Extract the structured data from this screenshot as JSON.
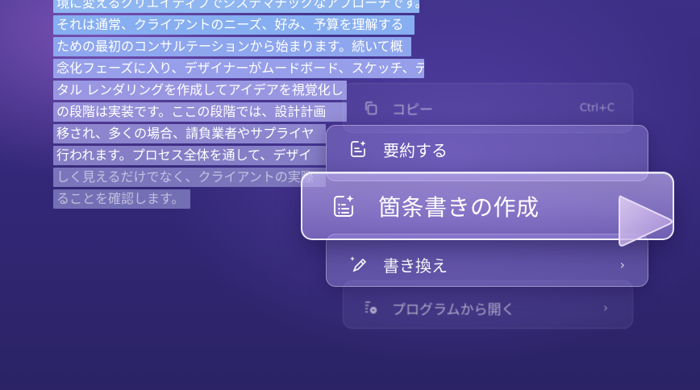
{
  "document": {
    "lines": [
      {
        "text": "境に変えるクリエイティブでシステマチックなアプローチです。",
        "color": "#8fb6f0"
      },
      {
        "text": "それは通常、クライアントのニーズ、好み、予算を理解する",
        "color": "#86aef0"
      },
      {
        "text": "ための最初のコンサルテーションから始まります。続いて概",
        "color": "#8ea6ee"
      },
      {
        "text": "念化フェーズに入り、デザイナーがムードボード、スケッチ、デジ",
        "color": "#979fea"
      },
      {
        "text": "タル レンダリングを作成してアイデアを視覚化し",
        "color": "#9a97e2"
      },
      {
        "text": "の段階は実装です。ここの段階では、設計計画",
        "color": "#958ed8"
      },
      {
        "text": "移され、多くの場合、請負業者やサプライヤ",
        "color": "#8d86cf"
      },
      {
        "text": "行われます。プロセス全体を通して、デザイ",
        "color": "#857ec6"
      },
      {
        "text": "しく見えるだけでなく、クライアントの実際",
        "color": "#7b75bc"
      },
      {
        "text": "ることを確認します。",
        "color": "#736fb4"
      }
    ]
  },
  "context_menu": {
    "copy": {
      "label": "コピー",
      "shortcut": "Ctrl+C",
      "icon": "copy-icon"
    },
    "summarize": {
      "label": "要約する",
      "icon": "summarize-icon"
    },
    "bullets": {
      "label": "箇条書きの作成",
      "icon": "bullet-list-sparkle-icon"
    },
    "rewrite": {
      "label": "書き換え",
      "icon": "rewrite-pen-icon",
      "chevron": "›"
    },
    "open_with": {
      "label": "プログラムから開く",
      "icon": "open-with-icon",
      "chevron": "›"
    }
  },
  "colors": {
    "background": "#352a7c",
    "menu_highlight_border": "#ffffff",
    "pointer_fill": "#c9aee8"
  }
}
